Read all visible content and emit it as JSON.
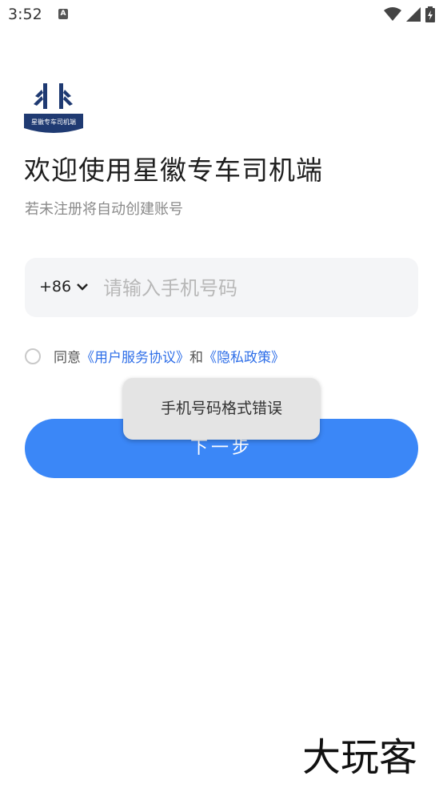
{
  "status_bar": {
    "time": "3:52",
    "notification_badge": "A"
  },
  "logo": {
    "text": "星徽专车司机端"
  },
  "header": {
    "title": "欢迎使用星徽专车司机端",
    "subtitle": "若未注册将自动创建账号"
  },
  "phone": {
    "country_code": "+86",
    "placeholder": "请输入手机号码",
    "value": ""
  },
  "agreement": {
    "prefix": "同意",
    "user_agreement": "《用户服务协议》",
    "conjunction": "和",
    "privacy_policy": "《隐私政策》",
    "checked": false
  },
  "next_button": {
    "label": "下一步"
  },
  "toast": {
    "message": "手机号码格式错误"
  },
  "watermark": {
    "text": "大玩客"
  },
  "colors": {
    "primary": "#3b87f7",
    "link": "#2f6fe8",
    "input_bg": "#f4f5f7",
    "logo_navy": "#1f3a72"
  }
}
